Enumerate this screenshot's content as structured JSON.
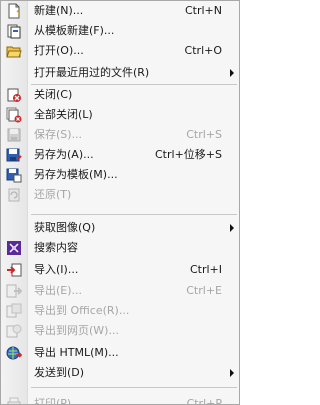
{
  "menu": {
    "items": {
      "new": {
        "label": "新建(N)...",
        "shortcut": "Ctrl+N"
      },
      "from_template": {
        "label": "从模板新建(F)..."
      },
      "open": {
        "label": "打开(O)...",
        "shortcut": "Ctrl+O"
      },
      "recent": {
        "label": "打开最近用过的文件(R)"
      },
      "close": {
        "label": "关闭(C)"
      },
      "close_all": {
        "label": "全部关闭(L)"
      },
      "save": {
        "label": "保存(S)...",
        "shortcut": "Ctrl+S"
      },
      "save_as": {
        "label": "另存为(A)...",
        "shortcut": "Ctrl+位移+S"
      },
      "save_as_template": {
        "label": "另存为模板(M)..."
      },
      "revert": {
        "label": "还原(T)"
      },
      "acquire": {
        "label": "获取图像(Q)"
      },
      "search": {
        "label": "搜索内容"
      },
      "import": {
        "label": "导入(I)...",
        "shortcut": "Ctrl+I"
      },
      "export": {
        "label": "导出(E)...",
        "shortcut": "Ctrl+E"
      },
      "export_office": {
        "label": "导出到 Office(R)..."
      },
      "export_web": {
        "label": "导出到网页(W)..."
      },
      "export_html": {
        "label": "导出 HTML(M)..."
      },
      "send_to": {
        "label": "发送到(D)"
      },
      "print": {
        "label": "打印(P)...",
        "shortcut": "Ctrl+P"
      }
    }
  },
  "icons": {
    "new": "new-document-icon",
    "from_template": "template-icon",
    "open": "open-folder-icon",
    "close": "close-document-icon",
    "close_all": "close-all-icon",
    "save": "save-icon",
    "save_as": "save-as-icon",
    "save_as_template": "save-template-icon",
    "revert": "revert-icon",
    "search": "search-content-icon",
    "import": "import-icon",
    "export": "export-icon",
    "export_office": "export-office-icon",
    "export_web": "export-web-icon",
    "export_html": "export-html-icon",
    "print": "print-icon"
  },
  "colors": {
    "menu_bg": "#f6f6f6",
    "gutter": "#e9e9e9",
    "text": "#1a1a1a",
    "disabled_text": "#a6a6a6",
    "icon_blue": "#2f5fb0",
    "icon_red": "#cc2a2a",
    "icon_purple": "#5a2a9a"
  }
}
